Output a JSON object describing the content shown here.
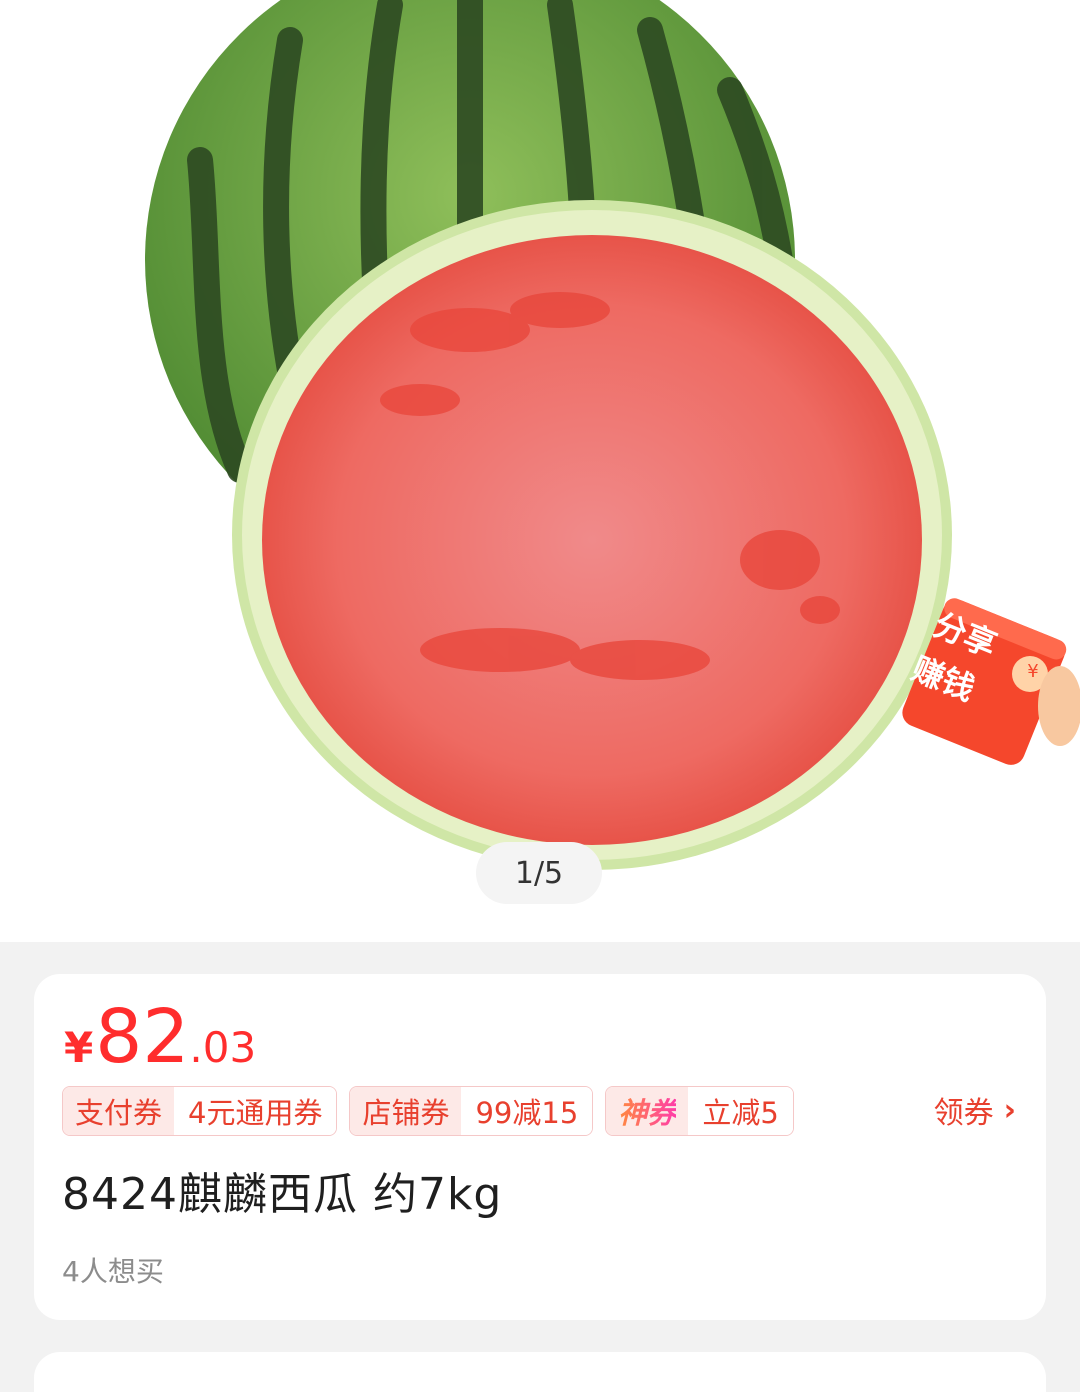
{
  "gallery": {
    "pager": "1/5"
  },
  "share": {
    "label_line1": "分享",
    "label_line2": "赚钱",
    "coin_symbol": "¥"
  },
  "product": {
    "price_symbol": "¥",
    "price_integer": "82",
    "price_decimal": ".03",
    "coupons": [
      {
        "type": "支付券",
        "value": "4元通用券"
      },
      {
        "type": "店铺券",
        "value": "99减15"
      },
      {
        "type": "神券",
        "value": "立减5"
      }
    ],
    "get_coupon_label": "领券",
    "title": "8424麒麟西瓜 约7kg",
    "wants": "4人想买"
  },
  "colors": {
    "price_red": "#ff2d2d",
    "coupon_red": "#e8402e",
    "coupon_bg": "#fde9e7",
    "page_bg": "#f2f2f2"
  },
  "icons": {
    "chevron": "chevron-right-icon"
  }
}
